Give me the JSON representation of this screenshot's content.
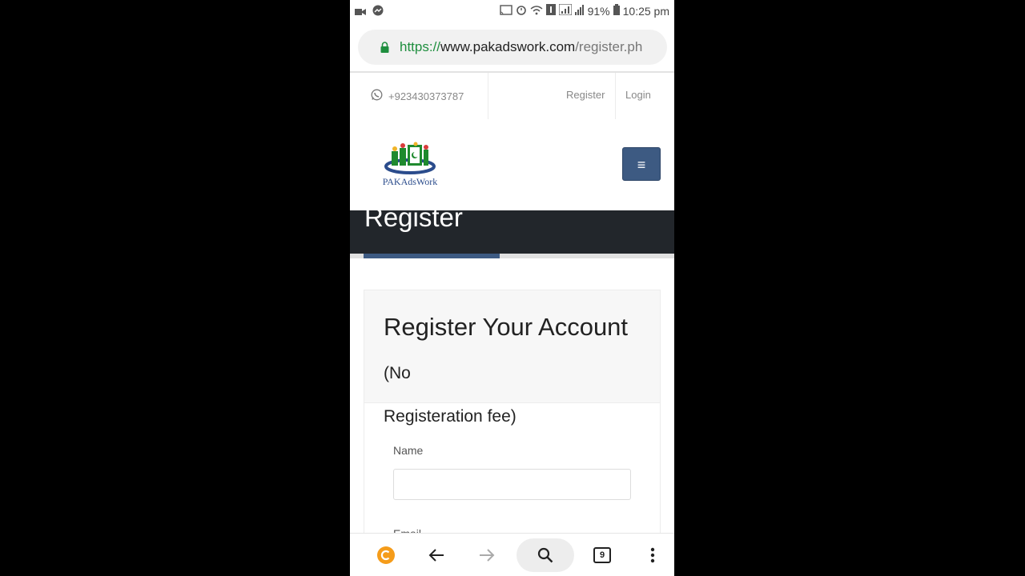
{
  "status_bar": {
    "battery": "91%",
    "time": "10:25 pm"
  },
  "browser": {
    "url_scheme": "https://",
    "url_host": "www.pakadswork.com",
    "url_path": "/register.ph",
    "tab_count": "9"
  },
  "topbar": {
    "phone": "+923430373787",
    "register_label": "Register",
    "login_label": "Login"
  },
  "header": {
    "logo_text": "PAKAdsWork",
    "menu_icon": "≡"
  },
  "banner": {
    "title": "Register"
  },
  "form": {
    "title_main": "Register Your Account",
    "title_sub_part1": "(No",
    "title_sub_part2": "Registeration fee)",
    "name_label": "Name",
    "name_value": "",
    "email_label": "Email"
  },
  "colors": {
    "accent": "#3d5a82",
    "banner_bg": "#22262b",
    "url_green": "#1e8e3e"
  }
}
